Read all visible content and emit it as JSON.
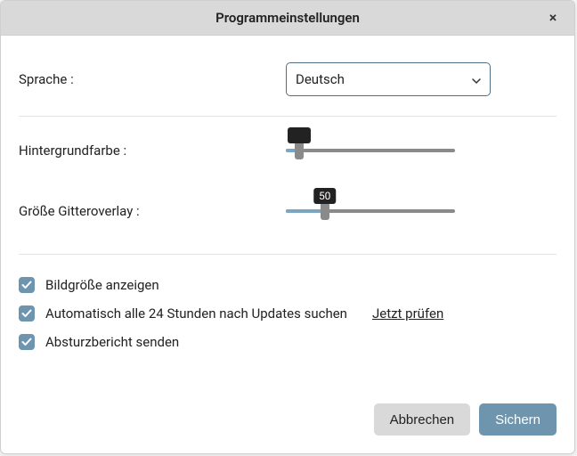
{
  "title": "Programmeinstellungen",
  "labels": {
    "language": "Sprache :",
    "bgcolor": "Hintergrundfarbe :",
    "gridsize": "Größe Gitteroverlay :"
  },
  "language": {
    "selected": "Deutsch"
  },
  "sliders": {
    "bgcolor": {
      "value": 8,
      "min": 0,
      "max": 100,
      "tooltip": ""
    },
    "gridsize": {
      "value": 23,
      "min": 0,
      "max": 100,
      "tooltip": "50"
    }
  },
  "checks": {
    "showSize": {
      "checked": true,
      "label": "Bildgröße anzeigen"
    },
    "autoUpdate": {
      "checked": true,
      "label": "Automatisch alle 24 Stunden nach Updates suchen",
      "link": "Jetzt prüfen"
    },
    "crashReport": {
      "checked": true,
      "label": "Absturzbericht senden"
    }
  },
  "buttons": {
    "cancel": "Abbrechen",
    "save": "Sichern"
  }
}
